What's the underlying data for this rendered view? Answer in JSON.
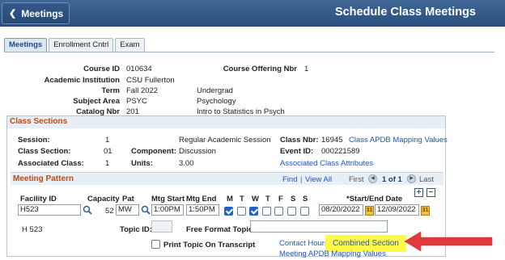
{
  "header": {
    "back_label": "Meetings",
    "title": "Schedule Class Meetings"
  },
  "tabs": [
    {
      "label": "Meetings"
    },
    {
      "label": "Enrollment Cntrl"
    },
    {
      "label": "Exam"
    }
  ],
  "course": {
    "course_id_label": "Course ID",
    "course_id": "010634",
    "offering_label": "Course Offering Nbr",
    "offering": "1",
    "institution_label": "Academic Institution",
    "institution": "CSU Fullerton",
    "term_label": "Term",
    "term": "Fall 2022",
    "term_desc": "Undergrad",
    "subject_label": "Subject Area",
    "subject": "PSYC",
    "subject_desc": "Psychology",
    "catalog_label": "Catalog Nbr",
    "catalog": "201",
    "catalog_desc": "Intro to Statistics in Psych"
  },
  "class_sections": {
    "title": "Class Sections",
    "session_label": "Session:",
    "session": "1",
    "session_desc": "Regular Academic Session",
    "class_nbr_label": "Class Nbr:",
    "class_nbr": "16945",
    "mapping_link": "Class APDB Mapping Values",
    "section_label": "Class Section:",
    "section": "01",
    "component_label": "Component:",
    "component": "Discussion",
    "event_label": "Event ID:",
    "event": "000221589",
    "assoc_label": "Associated Class:",
    "assoc": "1",
    "units_label": "Units:",
    "units": "3.00",
    "attr_link": "Associated Class Attributes"
  },
  "meeting_pattern": {
    "title": "Meeting Pattern",
    "find": "Find",
    "sep": "|",
    "view_all": "View All",
    "first": "First",
    "pager": "1 of 1",
    "last": "Last",
    "headers": {
      "facility": "Facility ID",
      "capacity": "Capacity",
      "pat": "Pat",
      "start": "Mtg Start",
      "end": "Mtg End",
      "m": "M",
      "t": "T",
      "w": "W",
      "th": "T",
      "f": "F",
      "s": "S",
      "su": "S",
      "dates": "*Start/End Date"
    },
    "facility": "H523",
    "capacity": "52",
    "pat": "MW",
    "start": "1:00PM",
    "end": "1:50PM",
    "days": {
      "M": true,
      "T": false,
      "W": true,
      "Th": false,
      "F": false,
      "S": false,
      "Su": false
    },
    "start_date": "08/20/2022",
    "end_date": "12/09/2022",
    "facility_desc": "H 523",
    "topic_label": "Topic ID:",
    "free_topic_label": "Free Format Topic:",
    "print_topic_label": "Print Topic On Transcript",
    "contact_hours": "Contact Hours",
    "combined": "Combined Section",
    "meeting_mapping": "Meeting APDB Mapping Values"
  },
  "colors": {
    "header": "#2b4f7e",
    "section_title": "#c14a12",
    "link": "#1f55b8",
    "highlight": "#fff94a",
    "arrow": "#e23a3a"
  }
}
